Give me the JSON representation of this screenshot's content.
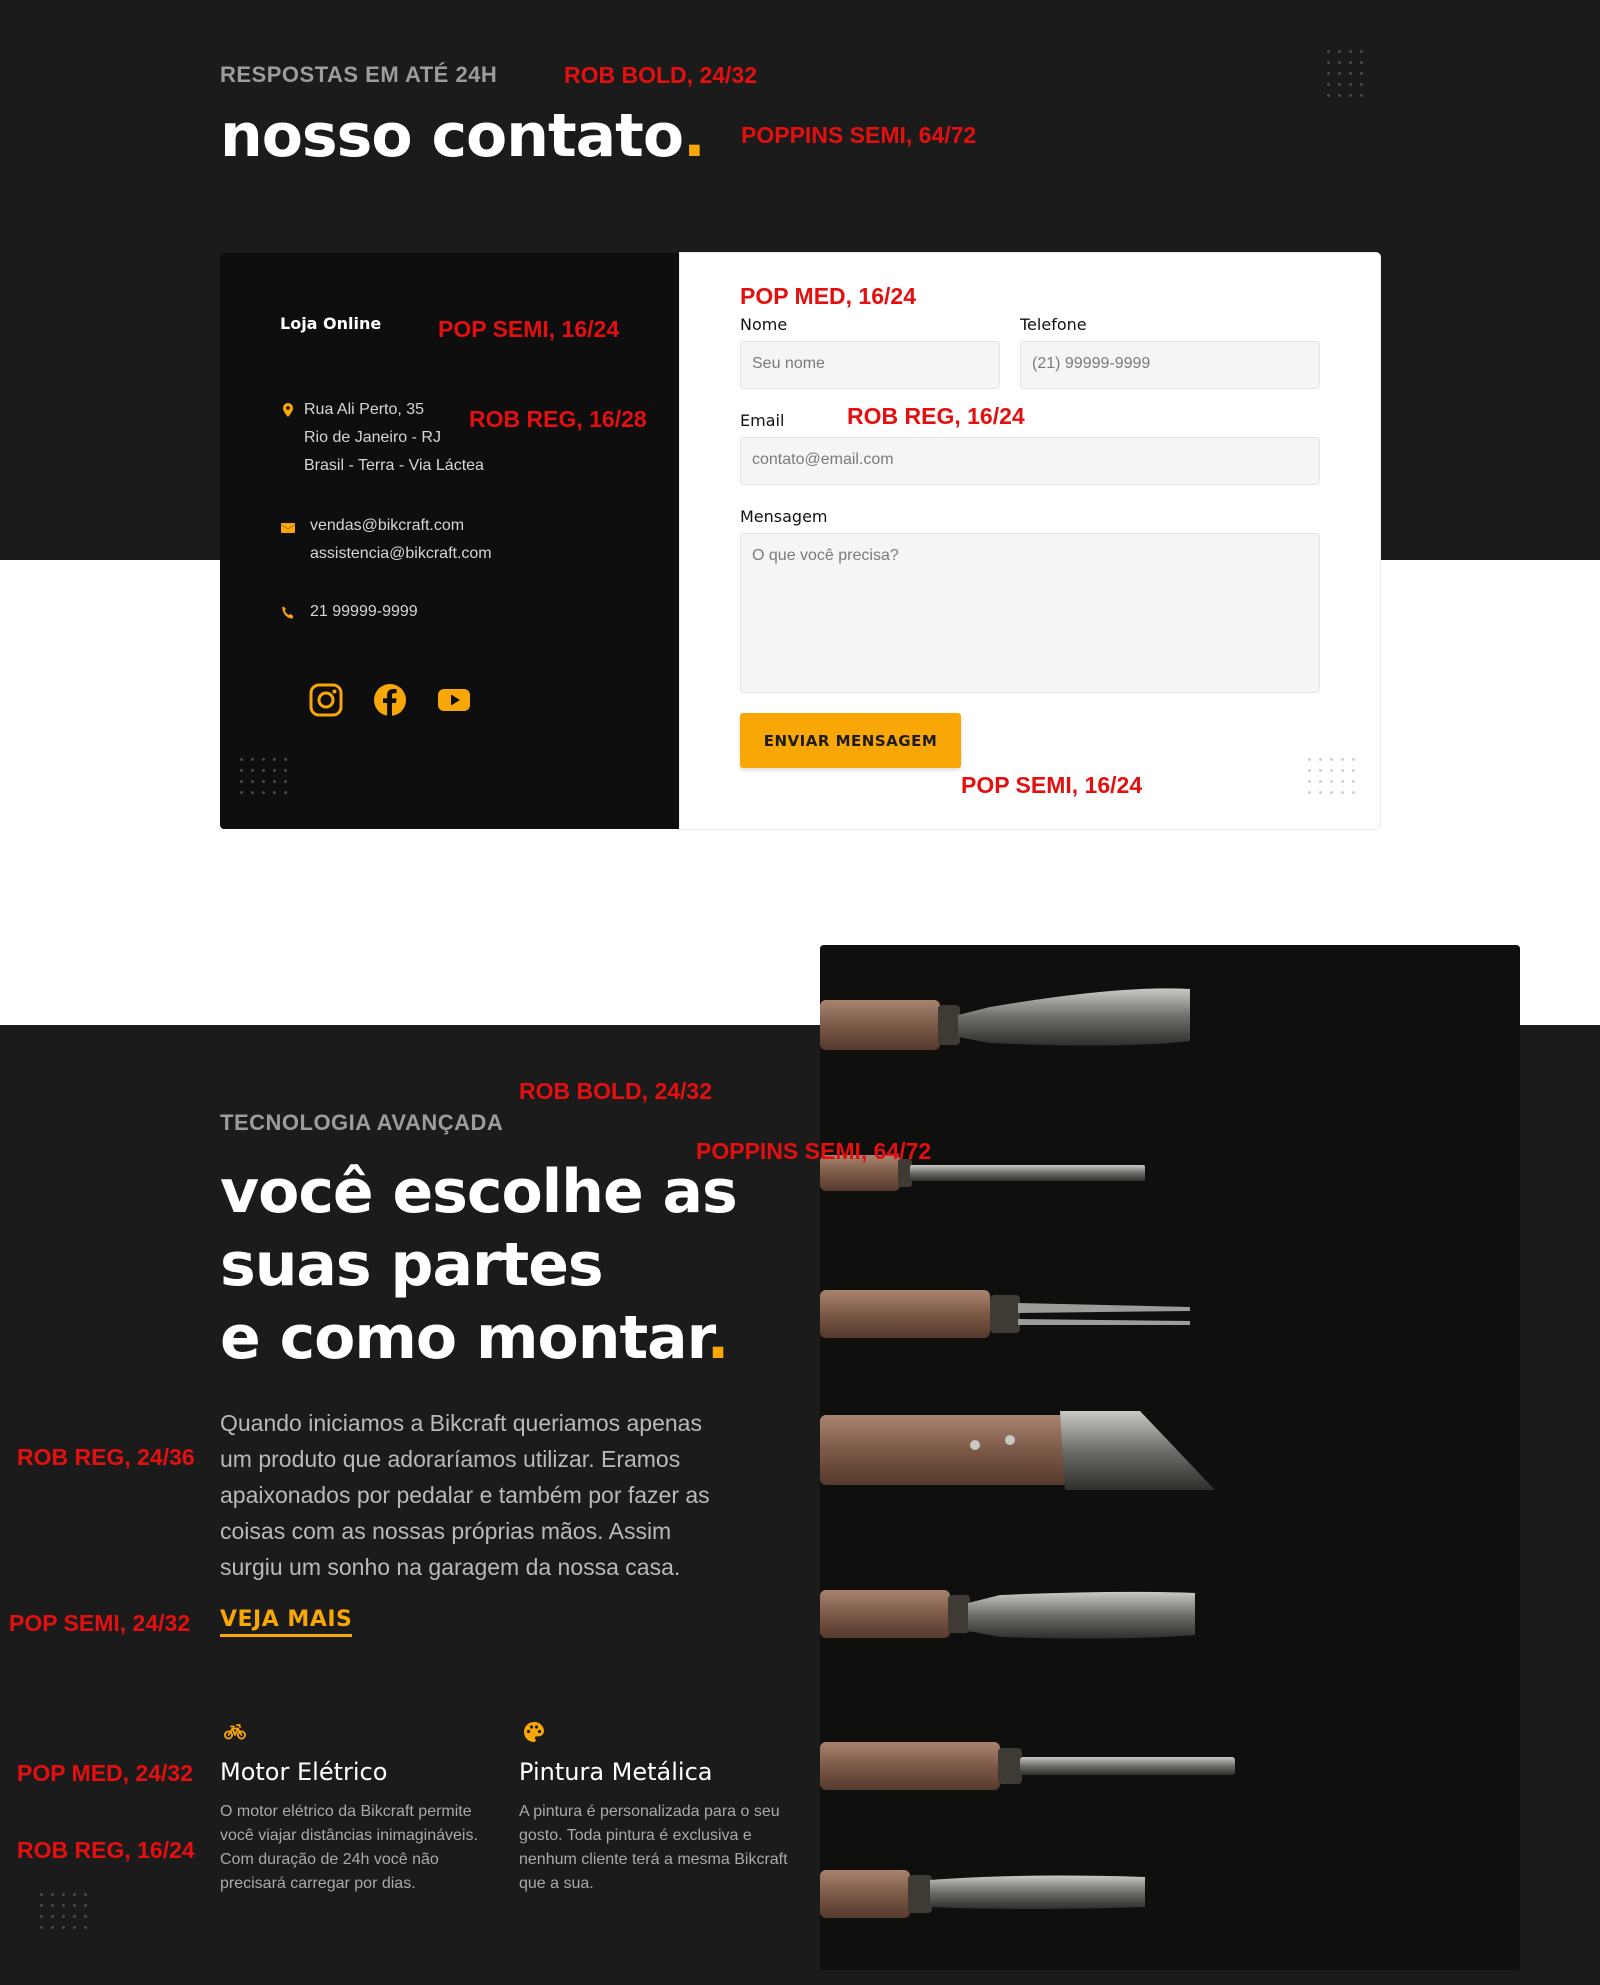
{
  "contact": {
    "eyebrow": "RESPOSTAS EM ATÉ 24H",
    "title": "nosso contato",
    "title_dot": ".",
    "store": {
      "title": "Loja Online",
      "address": [
        "Rua Ali Perto, 35",
        "Rio de Janeiro - RJ",
        "Brasil - Terra - Via Láctea"
      ],
      "emails": [
        "vendas@bikcraft.com",
        "assistencia@bikcraft.com"
      ],
      "phone": "21 99999-9999",
      "social": [
        "instagram-icon",
        "facebook-icon",
        "youtube-icon"
      ]
    },
    "form": {
      "name_label": "Nome",
      "name_placeholder": "Seu nome",
      "phone_label": "Telefone",
      "phone_placeholder": "(21) 99999-9999",
      "email_label": "Email",
      "email_placeholder": "contato@email.com",
      "message_label": "Mensagem",
      "message_placeholder": "O que você precisa?",
      "submit": "ENVIAR MENSAGEM"
    }
  },
  "tech": {
    "eyebrow": "TECNOLOGIA AVANÇADA",
    "title_lines": [
      "você escolhe as",
      "suas partes",
      "e como montar"
    ],
    "title_dot": ".",
    "paragraph": "Quando iniciamos a Bikcraft queriamos apenas um produto que adoraríamos utilizar. Eramos apaixonados por pedalar e também por fazer as coisas com as nossas próprias mãos. Assim surgiu um sonho na garagem da nossa casa.",
    "cta": "VEJA MAIS",
    "features": [
      {
        "icon": "bike-icon",
        "title": "Motor Elétrico",
        "text": "O motor elétrico da Bikcraft permite você viajar distâncias inimagináveis. Com duração de 24h você não precisará carregar por dias."
      },
      {
        "icon": "palette-icon",
        "title": "Pintura Metálica",
        "text": "A pintura é personalizada para o seu gosto. Toda pintura é exclusiva e nenhum cliente terá a mesma Bikcraft que a sua."
      }
    ]
  },
  "annotations": {
    "a1": "ROB BOLD, 24/32",
    "a2": "POPPINS SEMI, 64/72",
    "a3": "POP SEMI, 16/24",
    "a4": "ROB REG, 16/28",
    "a5": "POP MED, 16/24",
    "a6": "ROB REG, 16/24",
    "a7": "POP SEMI, 16/24",
    "a8": "ROB BOLD, 24/32",
    "a9": "POPPINS SEMI, 64/72",
    "a10": "ROB REG, 24/36",
    "a11": "POP SEMI, 24/32",
    "a12": "POP MED, 24/32",
    "a13": "ROB REG, 16/24"
  },
  "colors": {
    "accent": "#f9a706",
    "dark_bg": "#1b1b1b",
    "card_dark": "#0e0e0e",
    "annotation": "#e3100f"
  }
}
